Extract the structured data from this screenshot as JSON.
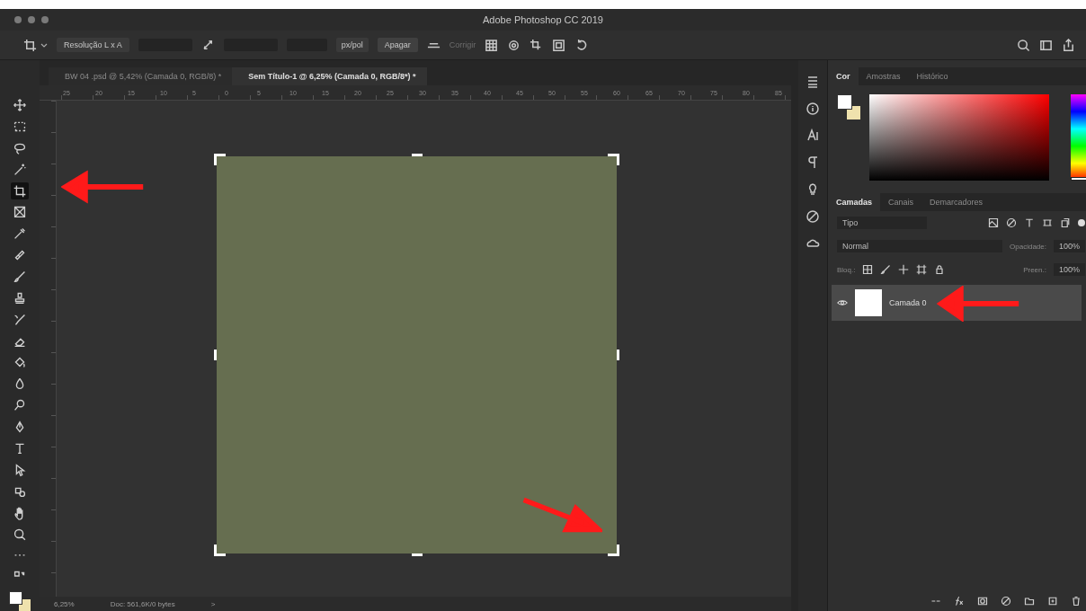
{
  "window": {
    "title": "Adobe Photoshop CC 2019"
  },
  "options_bar": {
    "ratio": "Resolução L x A",
    "units": "px/pol",
    "clear": "Apagar",
    "straighten": "Corrigir"
  },
  "document_tabs": [
    {
      "label": "BW 04 .psd @ 5,42% (Camada 0, RGB/8) *",
      "selected": false
    },
    {
      "label": "Sem Título-1 @ 6,25% (Camada 0, RGB/8*) *",
      "selected": true
    }
  ],
  "ruler": {
    "labels": [
      "25",
      "20",
      "15",
      "10",
      "5",
      "0",
      "5",
      "10",
      "15",
      "20",
      "25",
      "30",
      "35",
      "40",
      "45",
      "50",
      "55",
      "60",
      "65",
      "70",
      "75",
      "80",
      "85"
    ]
  },
  "tools": [
    {
      "selected": false
    },
    {
      "selected": false
    },
    {
      "selected": false
    },
    {
      "selected": false
    },
    {
      "selected": true
    },
    {
      "selected": false
    },
    {
      "selected": false
    },
    {
      "selected": false
    },
    {
      "selected": false
    },
    {
      "selected": false
    },
    {
      "selected": false
    },
    {
      "selected": false
    },
    {
      "selected": false
    },
    {
      "selected": false
    },
    {
      "selected": false
    },
    {
      "selected": false
    },
    {
      "selected": false
    },
    {
      "selected": false
    },
    {
      "selected": false
    },
    {
      "selected": false
    },
    {
      "selected": false
    },
    {
      "selected": false
    }
  ],
  "color_panel": {
    "tabs": [
      {
        "label": "Cor",
        "selected": true
      },
      {
        "label": "Amostras",
        "selected": false
      },
      {
        "label": "Histórico",
        "selected": false
      }
    ],
    "hue": {
      "level": 0
    }
  },
  "layers_panel": {
    "tabs": [
      {
        "label": "Camadas",
        "selected": true
      },
      {
        "label": "Canais",
        "selected": false
      },
      {
        "label": "Demarcadores",
        "selected": false
      }
    ],
    "filter": "Tipo",
    "blend_mode": "Normal",
    "opacity_label": "Opacidade:",
    "opacity": "100%",
    "lock_label": "Bloq.:",
    "fill_label": "Preen.:",
    "fill": "100%",
    "layers": [
      {
        "name": "Camada 0",
        "visible": true,
        "selected": true
      }
    ]
  },
  "status_bar": {
    "zoom": "6,25%",
    "doc": "Doc: 561,6K/0 bytes",
    "arrow": ">"
  }
}
